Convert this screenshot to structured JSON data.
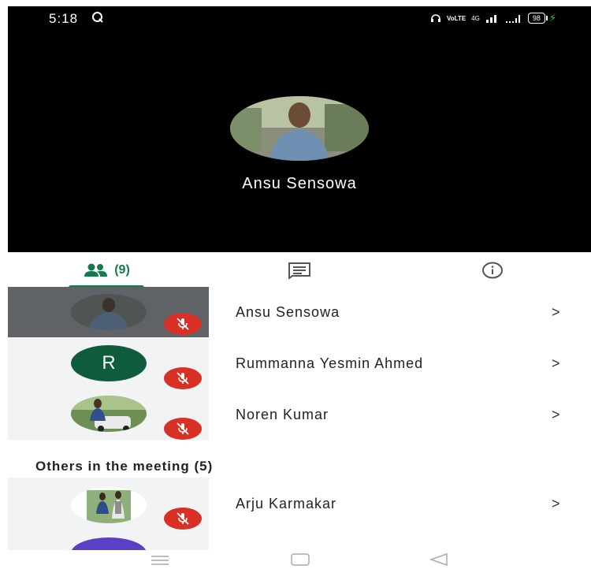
{
  "status_bar": {
    "time": "5:18",
    "vo_lte_label": "VoLTE",
    "network_label": "4G",
    "battery_level": "98"
  },
  "speaker": {
    "name": "Ansu Sensowa"
  },
  "tabs": {
    "people_count": "(9)",
    "active": "people"
  },
  "participants": [
    {
      "name": "Ansu Sensowa",
      "muted": true,
      "chevron": ">"
    },
    {
      "name": "Rummanna Yesmin Ahmed",
      "initial": "R",
      "muted": true,
      "chevron": ">"
    },
    {
      "name": "Noren Kumar",
      "muted": true,
      "chevron": ">"
    }
  ],
  "others_section": {
    "title": "Others in the meeting (5)",
    "participants": [
      {
        "name": "Arju Karmakar",
        "muted": true,
        "chevron": ">"
      }
    ]
  },
  "colors": {
    "accent": "#137a4b",
    "mute_red": "#d93025",
    "avatar_green": "#0f5c3d",
    "avatar_purple": "#5b3fc4"
  },
  "icons": {
    "people_tab": "people-icon",
    "chat_tab": "chat-icon",
    "info_tab": "info-icon",
    "muted": "mic-off-icon",
    "nav_menu": "menu-icon",
    "nav_home": "home-icon",
    "nav_back": "back-icon"
  }
}
